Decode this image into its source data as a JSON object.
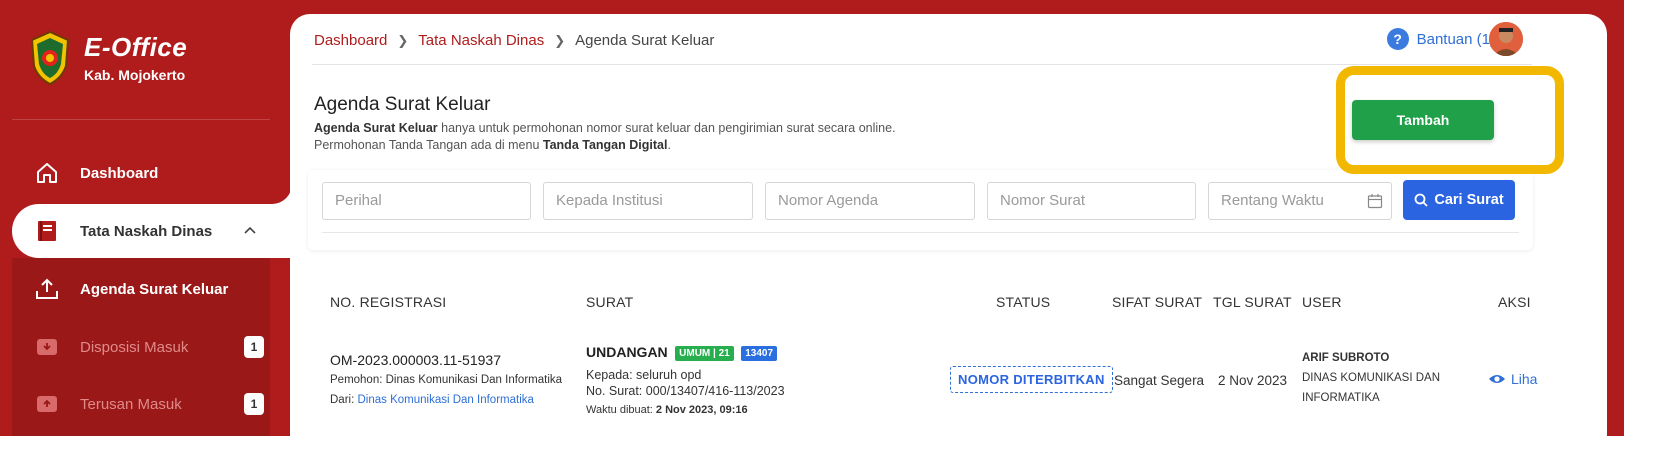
{
  "sidebar": {
    "app_title": "E-Office",
    "app_subtitle": "Kab. Mojokerto",
    "items": [
      {
        "label": "Dashboard",
        "icon": "home-icon"
      },
      {
        "label": "Tata Naskah Dinas",
        "icon": "document-icon",
        "expanded": true
      },
      {
        "label": "Agenda Surat Keluar",
        "icon": "upload-icon",
        "active": true
      },
      {
        "label": "Disposisi Masuk",
        "icon": "inbox-icon",
        "badge": "1"
      },
      {
        "label": "Terusan Masuk",
        "icon": "inbox-icon",
        "badge": "1"
      }
    ]
  },
  "header": {
    "breadcrumb": [
      "Dashboard",
      "Tata Naskah Dinas",
      "Agenda Surat Keluar"
    ],
    "help_label": "Bantuan (1)"
  },
  "page": {
    "title": "Agenda Surat Keluar",
    "desc_bold1": "Agenda Surat Keluar",
    "desc_text1": " hanya untuk permohonan nomor surat keluar dan pengirimian surat secara online.",
    "desc_text2": "Permohonan Tanda Tangan ada di menu ",
    "desc_bold2": "Tanda Tangan Digital",
    "desc_text3": ".",
    "add_button": "Tambah"
  },
  "filters": {
    "perihal": "Perihal",
    "kepada": "Kepada Institusi",
    "nomor_agenda": "Nomor Agenda",
    "nomor_surat": "Nomor Surat",
    "rentang_waktu": "Rentang Waktu",
    "search_button": "Cari Surat"
  },
  "table": {
    "columns": [
      "NO. REGISTRASI",
      "SURAT",
      "STATUS",
      "SIFAT SURAT",
      "TGL SURAT",
      "USER",
      "AKSI"
    ],
    "rows": [
      {
        "reg_no": "OM-2023.000003.11-51937",
        "pemohon_label": "Pemohon: ",
        "pemohon": "Dinas Komunikasi Dan Informatika",
        "dari_label": "Dari: ",
        "dari": "Dinas Komunikasi Dan Informatika",
        "surat_type": "UNDANGAN",
        "tag1": "UMUM | 21",
        "tag2": "13407",
        "kepada": "Kepada: seluruh opd",
        "no_surat": "No. Surat: 000/13407/416-113/2023",
        "waktu_label": "Waktu dibuat: ",
        "waktu": "2 Nov 2023, 09:16",
        "status": "NOMOR DITERBITKAN",
        "sifat": "Sangat Segera",
        "tgl": "2 Nov 2023",
        "user_name": "ARIF SUBROTO",
        "user_unit_1": "DINAS KOMUNIKASI DAN",
        "user_unit_2": "INFORMATIKA",
        "aksi": "Liha"
      }
    ]
  },
  "colors": {
    "brand_red": "#b01c1c",
    "add_green": "#21a04a",
    "search_blue": "#2a64e0",
    "highlight_yellow": "#f2b800"
  }
}
